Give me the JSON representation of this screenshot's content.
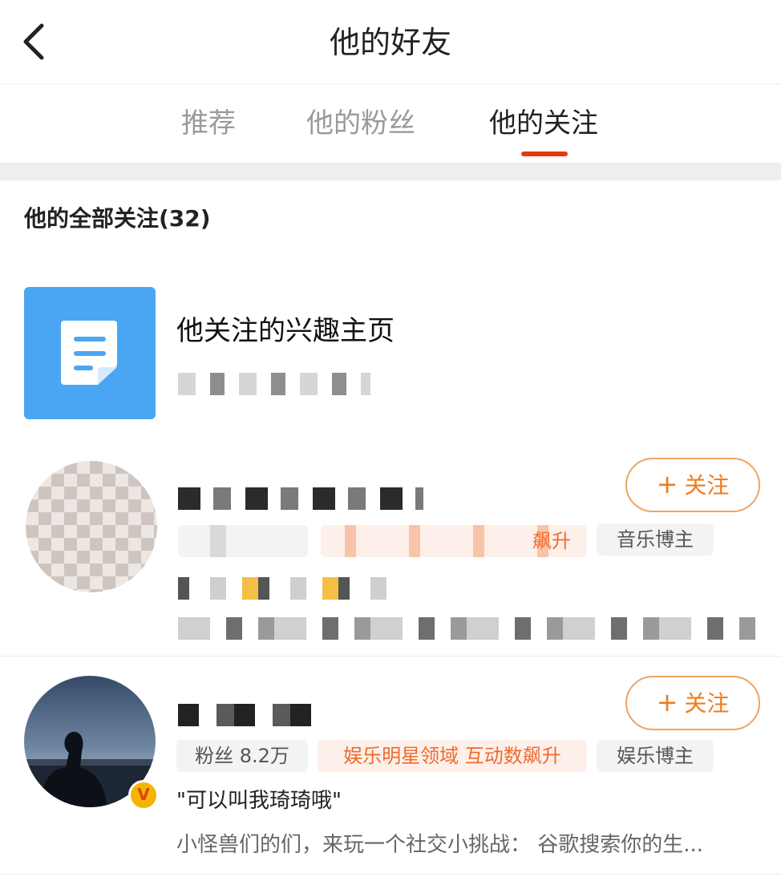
{
  "header": {
    "title": "他的好友",
    "back_icon": "chevron-left-icon"
  },
  "tabs": [
    {
      "label": "推荐",
      "active": false
    },
    {
      "label": "他的粉丝",
      "active": false
    },
    {
      "label": "他的关注",
      "active": true
    }
  ],
  "colors": {
    "accent": "#e8380d",
    "follow": "#ee7d1d",
    "interest_icon_bg": "#4aa6f2",
    "verified_badge": "#f4b400"
  },
  "section": {
    "title": "他的全部关注(32)"
  },
  "interest_page": {
    "title": "他关注的兴趣主页",
    "icon": "document-icon"
  },
  "users": [
    {
      "follow_label": "关注",
      "tags": [
        "飙升",
        "音乐博主"
      ]
    },
    {
      "follow_label": "关注",
      "tags": [
        "粉丝 8.2万",
        "娱乐明星领域 互动数飙升",
        "娱乐博主"
      ],
      "quote": "\"可以叫我琦琦哦\"",
      "description": "小怪兽们的们，来玩一个社交小挑战： 谷歌搜索你的生...",
      "verified_icon": "verified-v-icon",
      "verified_text": "V"
    }
  ]
}
